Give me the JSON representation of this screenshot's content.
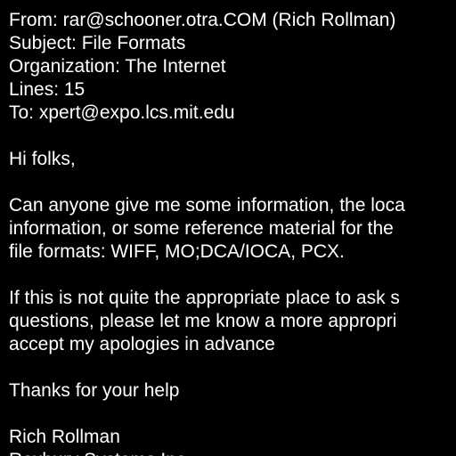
{
  "message": {
    "headers": {
      "from": "From: rar@schooner.otra.COM (Rich Rollman)",
      "subject": "Subject: File Formats",
      "organization": "Organization: The Internet",
      "lines": "Lines: 15",
      "to": "To: xpert@expo.lcs.mit.edu"
    },
    "body": {
      "greeting": "Hi folks,",
      "paragraph1": [
        "Can anyone give me some information, the loca",
        "information, or some reference material for the",
        "file formats: WIFF, MO;DCA/IOCA, PCX."
      ],
      "paragraph2": [
        "If this is not quite the appropriate place to ask s",
        "questions, please let me know a more appropri",
        "accept my apologies in advance"
      ],
      "thanks": "Thanks for your help",
      "signature": "Rich Rollman",
      "signature_line2": "Roxbury Systems Inc."
    }
  },
  "colors": {
    "background": "#000000",
    "text": "#ffffff"
  }
}
